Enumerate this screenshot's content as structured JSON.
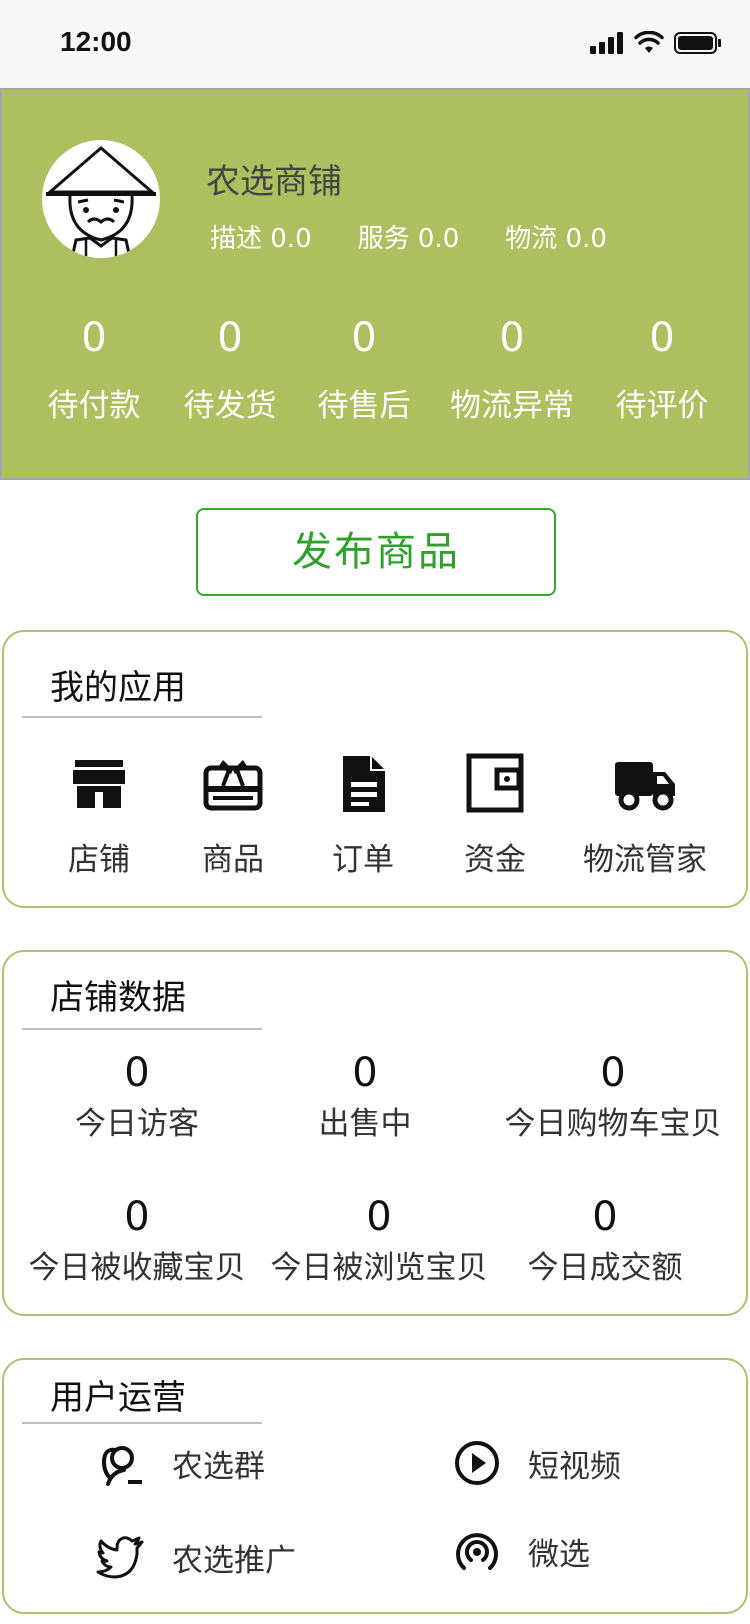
{
  "status_bar": {
    "time": "12:00"
  },
  "header": {
    "shop_name": "农选商铺",
    "ratings": {
      "describe": "描述 0.0",
      "service": "服务 0.0",
      "logistics": "物流 0.0"
    },
    "stats": [
      {
        "value": "0",
        "label": "待付款"
      },
      {
        "value": "0",
        "label": "待发货"
      },
      {
        "value": "0",
        "label": "待售后"
      },
      {
        "value": "0",
        "label": "物流异常"
      },
      {
        "value": "0",
        "label": "待评价"
      }
    ]
  },
  "publish_button": {
    "label": "发布商品"
  },
  "my_apps": {
    "title": "我的应用",
    "items": [
      {
        "label": "店铺",
        "icon": "store-icon"
      },
      {
        "label": "商品",
        "icon": "gift-card-icon"
      },
      {
        "label": "订单",
        "icon": "document-icon"
      },
      {
        "label": "资金",
        "icon": "wallet-icon"
      },
      {
        "label": "物流管家",
        "icon": "truck-icon"
      }
    ]
  },
  "shop_data": {
    "title": "店铺数据",
    "items": [
      {
        "value": "0",
        "label": "今日访客"
      },
      {
        "value": "0",
        "label": "出售中"
      },
      {
        "value": "0",
        "label": "今日购物车宝贝"
      },
      {
        "value": "0",
        "label": "今日被收藏宝贝"
      },
      {
        "value": "0",
        "label": "今日被浏览宝贝"
      },
      {
        "value": "0",
        "label": "今日成交额"
      }
    ]
  },
  "user_ops": {
    "title": "用户运营",
    "items": [
      {
        "label": "农选群",
        "icon": "user-group-icon"
      },
      {
        "label": "短视频",
        "icon": "play-circle-icon"
      },
      {
        "label": "农选推广",
        "icon": "twitter-bird-icon"
      },
      {
        "label": "微选",
        "icon": "broadcast-icon"
      }
    ]
  },
  "colors": {
    "header_bg": "#adbf5e",
    "accent_green": "#2ea12a",
    "card_border": "#b2bf71"
  }
}
